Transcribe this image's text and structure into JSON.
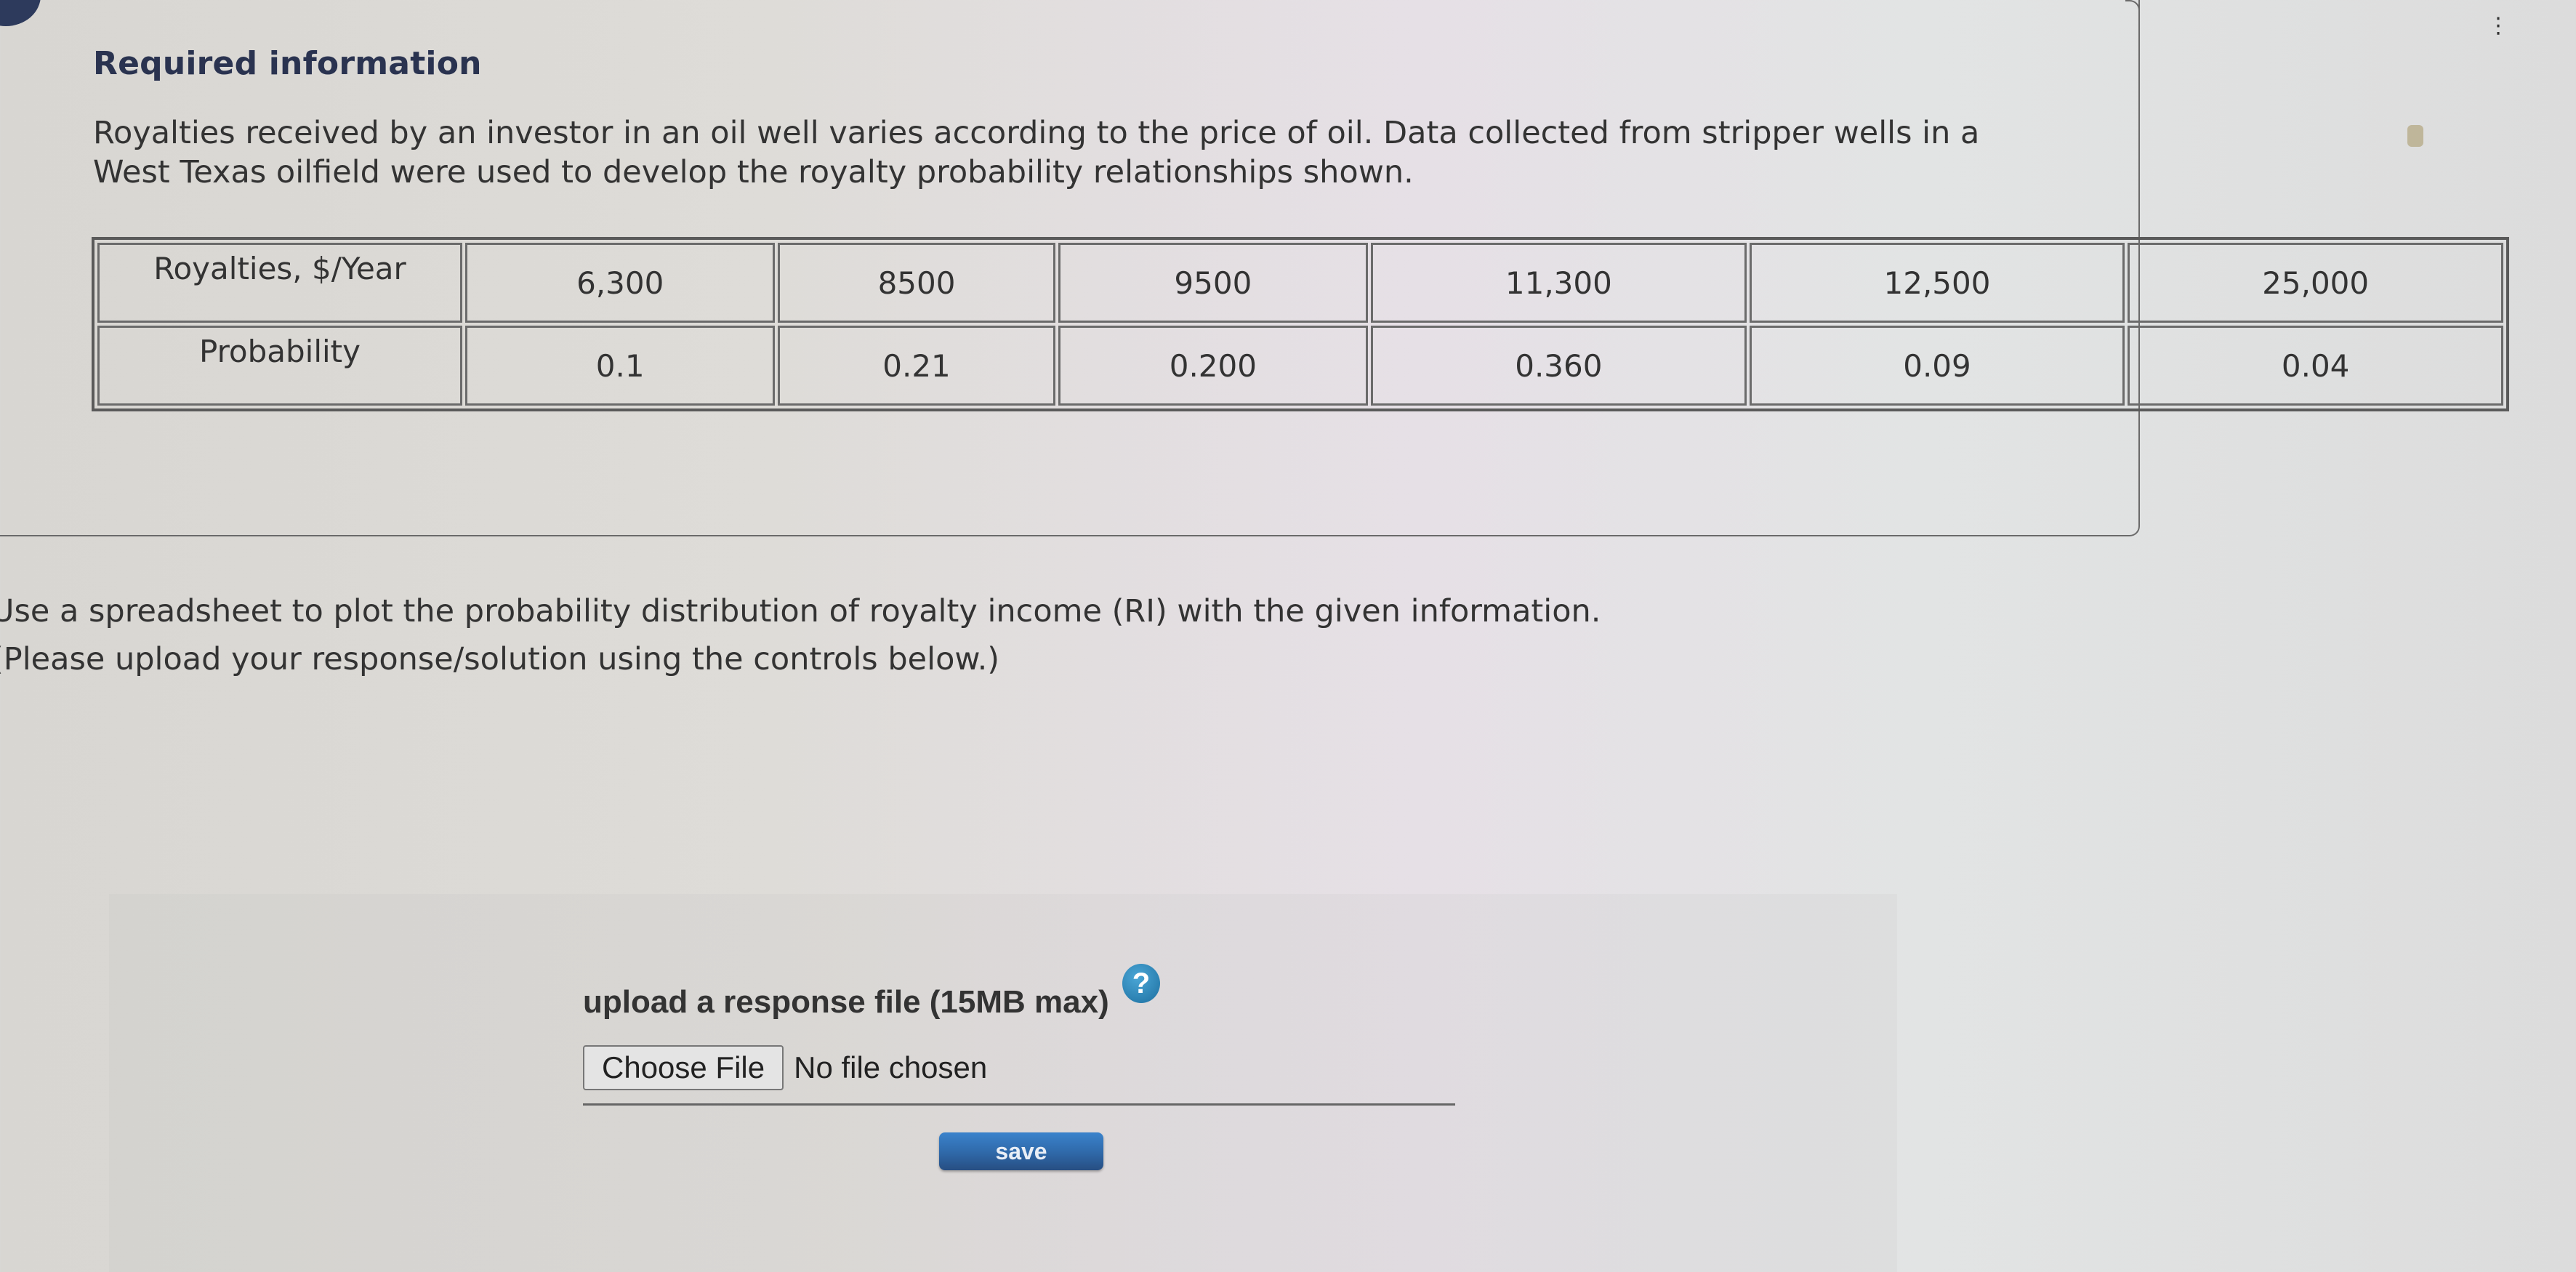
{
  "header": {
    "title": "Required information",
    "intro": "Royalties received by an investor in an oil well varies according to the price of oil. Data collected from stripper wells in a West Texas oilfield were used to develop the royalty probability relationships shown."
  },
  "table": {
    "rows": [
      {
        "label": "Royalties, $/Year",
        "values": [
          "6,300",
          "8500",
          "9500",
          "11,300",
          "12,500",
          "25,000"
        ]
      },
      {
        "label": "Probability",
        "values": [
          "0.1",
          "0.21",
          "0.200",
          "0.360",
          "0.09",
          "0.04"
        ]
      }
    ]
  },
  "instructions": {
    "line1": "Use a spreadsheet to plot the probability distribution of royalty income (RI) with the given information.",
    "line2": "(Please upload your response/solution using the controls below.)"
  },
  "upload": {
    "label": "upload a response file (15MB max)",
    "help_icon": "?",
    "choose_file_label": "Choose File",
    "file_status": "No file chosen",
    "save_label": "save"
  },
  "icons": {
    "menu": "⋮"
  },
  "colors": {
    "title": "#2a3350",
    "save_button": "#2f68a8",
    "help_icon": "#1d6fa0"
  }
}
